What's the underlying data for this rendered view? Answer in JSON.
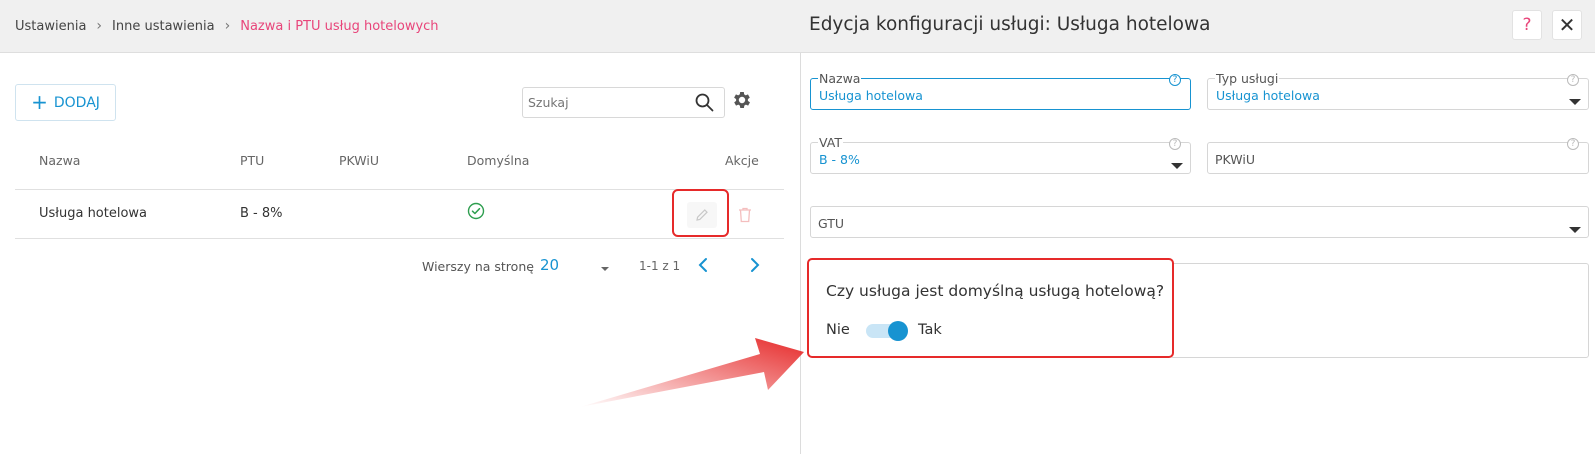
{
  "breadcrumb": {
    "items": [
      "Ustawienia",
      "Inne ustawienia"
    ],
    "active": "Nazwa i PTU usług hotelowych"
  },
  "panel": {
    "title": "Edycja konfiguracji usługi: Usługa hotelowa",
    "help_label": "?",
    "close_label": "✕"
  },
  "toolbar": {
    "add_label": "DODAJ",
    "search_placeholder": "Szukaj"
  },
  "table": {
    "columns": [
      "Nazwa",
      "PTU",
      "PKWiU",
      "Domyślna",
      "Akcje"
    ],
    "rows": [
      {
        "name": "Usługa hotelowa",
        "ptu": "B - 8%",
        "pkwiu": "",
        "default": true
      }
    ]
  },
  "pagination": {
    "rows_per_page_label": "Wierszy na stronę",
    "rows_per_page": "20",
    "range": "1-1 z 1"
  },
  "form": {
    "name": {
      "label": "Nazwa",
      "value": "Usługa hotelowa"
    },
    "service_type": {
      "label": "Typ usługi",
      "value": "Usługa hotelowa"
    },
    "vat": {
      "label": "VAT",
      "value": "B - 8%"
    },
    "pkwiu": {
      "placeholder": "PKWiU"
    },
    "gtu": {
      "placeholder": "GTU"
    },
    "default_toggle": {
      "question": "Czy usługa jest domyślną usługą hotelową?",
      "off_label": "Nie",
      "on_label": "Tak",
      "value": true
    }
  },
  "colors": {
    "accent": "#1793d1",
    "breadcrumb_active": "#e8457a",
    "highlight": "#e62a2a",
    "check": "#2e9e4f"
  }
}
